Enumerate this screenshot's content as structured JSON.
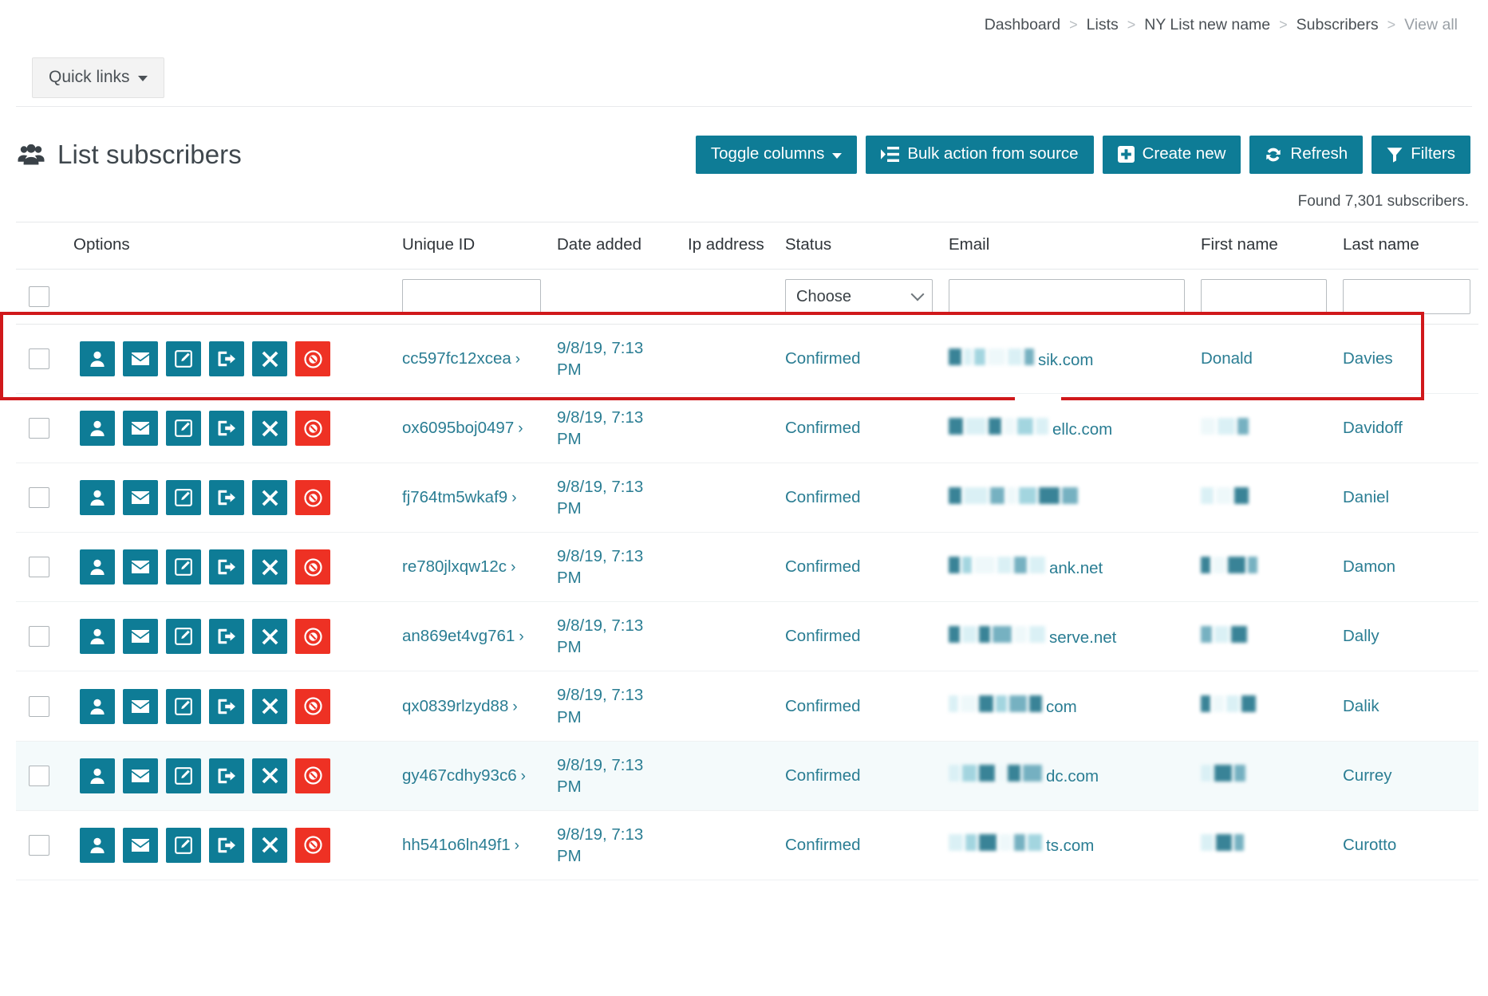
{
  "breadcrumb": {
    "items": [
      {
        "label": "Dashboard",
        "muted": false
      },
      {
        "label": "Lists",
        "muted": false
      },
      {
        "label": "NY List new name",
        "muted": false
      },
      {
        "label": "Subscribers",
        "muted": false
      },
      {
        "label": "View all",
        "muted": true
      }
    ],
    "separator": ">"
  },
  "quick_links": {
    "label": "Quick links"
  },
  "page": {
    "title": "List subscribers",
    "title_icon": "users-icon",
    "found_text": "Found 7,301 subscribers."
  },
  "toolbar": {
    "buttons": [
      {
        "label": "Toggle columns",
        "icon": "caret-down-icon",
        "style": "teal"
      },
      {
        "label": "Bulk action from source",
        "icon": "list-indent-icon",
        "style": "teal"
      },
      {
        "label": "Create new",
        "icon": "plus-square-icon",
        "style": "teal"
      },
      {
        "label": "Refresh",
        "icon": "refresh-icon",
        "style": "teal"
      },
      {
        "label": "Filters",
        "icon": "funnel-icon",
        "style": "teal"
      }
    ]
  },
  "colors": {
    "teal": "#0e7c96",
    "danger": "#ee3124",
    "link": "#2a7d93",
    "highlight": "#d0181b",
    "row_alt_bg": "#f4fafb"
  },
  "table": {
    "columns": [
      {
        "key": "checkbox",
        "label": ""
      },
      {
        "key": "options",
        "label": "Options"
      },
      {
        "key": "unique_id",
        "label": "Unique ID"
      },
      {
        "key": "date_added",
        "label": "Date added"
      },
      {
        "key": "ip_address",
        "label": "Ip address"
      },
      {
        "key": "status",
        "label": "Status"
      },
      {
        "key": "email",
        "label": "Email"
      },
      {
        "key": "first_name",
        "label": "First name"
      },
      {
        "key": "last_name",
        "label": "Last name"
      }
    ],
    "filter_row": {
      "unique_id_value": "",
      "status_value": "Choose",
      "email_value": "",
      "first_name_value": "",
      "last_name_value": ""
    },
    "row_actions": [
      {
        "name": "view-profile",
        "icon": "user-icon",
        "style": "teal"
      },
      {
        "name": "send-email",
        "icon": "envelope-icon",
        "style": "teal"
      },
      {
        "name": "edit",
        "icon": "pencil-square-icon",
        "style": "teal"
      },
      {
        "name": "unsubscribe",
        "icon": "sign-out-icon",
        "style": "teal"
      },
      {
        "name": "remove",
        "icon": "times-icon",
        "style": "teal"
      },
      {
        "name": "blacklist",
        "icon": "ban-circle-icon",
        "style": "danger"
      }
    ],
    "rows": [
      {
        "unique_id": "cc597fc12xcea",
        "date_added": "9/8/19, 7:13 PM",
        "ip_address": "",
        "status": "Confirmed",
        "email_visible_tail": "sik.com",
        "email_redacted": true,
        "first_name": "Donald",
        "first_name_redacted": false,
        "last_name": "Davies",
        "highlighted": true,
        "alt_bg": false
      },
      {
        "unique_id": "ox6095boj0497",
        "date_added": "9/8/19, 7:13 PM",
        "ip_address": "",
        "status": "Confirmed",
        "email_visible_tail": "ellc.com",
        "email_redacted": true,
        "first_name": "",
        "first_name_redacted": true,
        "last_name": "Davidoff",
        "highlighted": false,
        "alt_bg": false
      },
      {
        "unique_id": "fj764tm5wkaf9",
        "date_added": "9/8/19, 7:13 PM",
        "ip_address": "",
        "status": "Confirmed",
        "email_visible_tail": "",
        "email_redacted": true,
        "first_name": "",
        "first_name_redacted": true,
        "last_name": "Daniel",
        "highlighted": false,
        "alt_bg": false
      },
      {
        "unique_id": "re780jlxqw12c",
        "date_added": "9/8/19, 7:13 PM",
        "ip_address": "",
        "status": "Confirmed",
        "email_visible_tail": "ank.net",
        "email_redacted": true,
        "first_name": "",
        "first_name_redacted": true,
        "last_name": "Damon",
        "highlighted": false,
        "alt_bg": false
      },
      {
        "unique_id": "an869et4vg761",
        "date_added": "9/8/19, 7:13 PM",
        "ip_address": "",
        "status": "Confirmed",
        "email_visible_tail": "serve.net",
        "email_redacted": true,
        "first_name": "",
        "first_name_redacted": true,
        "last_name": "Dally",
        "highlighted": false,
        "alt_bg": false
      },
      {
        "unique_id": "qx0839rlzyd88",
        "date_added": "9/8/19, 7:13 PM",
        "ip_address": "",
        "status": "Confirmed",
        "email_visible_tail": "com",
        "email_redacted": true,
        "first_name": "",
        "first_name_redacted": true,
        "last_name": "Dalik",
        "highlighted": false,
        "alt_bg": false
      },
      {
        "unique_id": "gy467cdhy93c6",
        "date_added": "9/8/19, 7:13 PM",
        "ip_address": "",
        "status": "Confirmed",
        "email_visible_tail": "dc.com",
        "email_redacted": true,
        "first_name": "",
        "first_name_redacted": true,
        "last_name": "Currey",
        "highlighted": false,
        "alt_bg": true
      },
      {
        "unique_id": "hh541o6ln49f1",
        "date_added": "9/8/19, 7:13 PM",
        "ip_address": "",
        "status": "Confirmed",
        "email_visible_tail": "ts.com",
        "email_redacted": true,
        "first_name": "",
        "first_name_redacted": true,
        "last_name": "Curotto",
        "highlighted": false,
        "alt_bg": false
      }
    ]
  }
}
